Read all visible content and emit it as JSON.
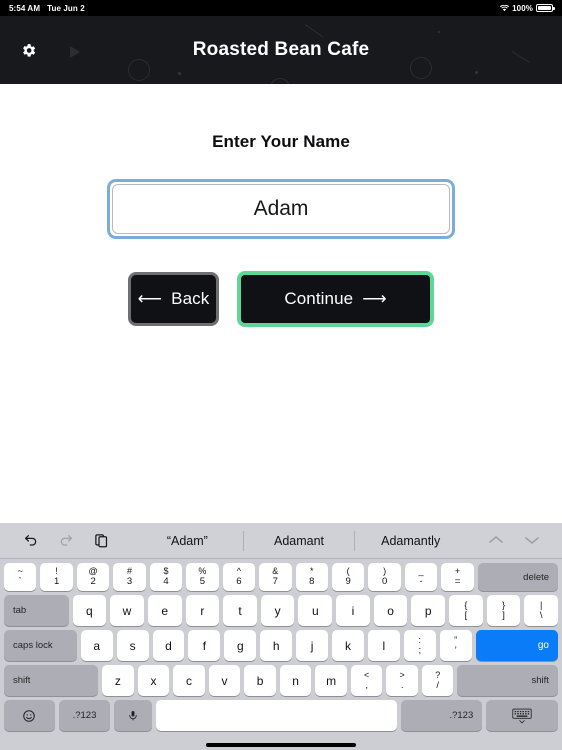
{
  "status_bar": {
    "time": "5:54 AM",
    "date": "Tue Jun 2",
    "battery_percent": "100%",
    "wifi_icon": "wifi-icon",
    "battery_icon": "battery-full-icon"
  },
  "app_header": {
    "title": "Roasted Bean Cafe",
    "settings_icon": "gear-icon",
    "background_color": "#17191c"
  },
  "main": {
    "heading": "Enter Your Name",
    "name_input": {
      "value": "Adam",
      "placeholder": "",
      "focus_ring_color": "#7cadd9"
    },
    "back_button": {
      "label": "Back",
      "icon": "arrow-left-icon",
      "border_color": "#6e6e73"
    },
    "continue_button": {
      "label": "Continue",
      "icon": "arrow-right-icon",
      "border_color": "#5fd695"
    }
  },
  "keyboard": {
    "suggestion_bar": {
      "undo_icon": "undo-icon",
      "redo_icon": "redo-icon",
      "paste_icon": "paste-icon",
      "suggestions": [
        "“Adam”",
        "Adamant",
        "Adamantly"
      ],
      "nav_up_icon": "chevron-up-icon",
      "nav_down_icon": "chevron-down-icon"
    },
    "rows": {
      "number_row": [
        {
          "type": "dual",
          "up": "~",
          "lo": "`"
        },
        {
          "type": "dual",
          "up": "!",
          "lo": "1"
        },
        {
          "type": "dual",
          "up": "@",
          "lo": "2"
        },
        {
          "type": "dual",
          "up": "#",
          "lo": "3"
        },
        {
          "type": "dual",
          "up": "$",
          "lo": "4"
        },
        {
          "type": "dual",
          "up": "%",
          "lo": "5"
        },
        {
          "type": "dual",
          "up": "^",
          "lo": "6"
        },
        {
          "type": "dual",
          "up": "&",
          "lo": "7"
        },
        {
          "type": "dual",
          "up": "*",
          "lo": "8"
        },
        {
          "type": "dual",
          "up": "(",
          "lo": "9"
        },
        {
          "type": "dual",
          "up": ")",
          "lo": "0"
        },
        {
          "type": "dual",
          "up": "_",
          "lo": "-"
        },
        {
          "type": "dual",
          "up": "+",
          "lo": "="
        },
        {
          "type": "mod",
          "label": "delete",
          "flex": 2.2,
          "align": "right"
        }
      ],
      "top_row": [
        {
          "type": "mod",
          "label": "tab",
          "flex": 1.65,
          "align": "left"
        },
        {
          "type": "key",
          "label": "q"
        },
        {
          "type": "key",
          "label": "w"
        },
        {
          "type": "key",
          "label": "e"
        },
        {
          "type": "key",
          "label": "r"
        },
        {
          "type": "key",
          "label": "t"
        },
        {
          "type": "key",
          "label": "y"
        },
        {
          "type": "key",
          "label": "u"
        },
        {
          "type": "key",
          "label": "i"
        },
        {
          "type": "key",
          "label": "o"
        },
        {
          "type": "key",
          "label": "p"
        },
        {
          "type": "dual",
          "up": "{",
          "lo": "["
        },
        {
          "type": "dual",
          "up": "}",
          "lo": "]"
        },
        {
          "type": "dual",
          "up": "|",
          "lo": "\\"
        }
      ],
      "home_row": [
        {
          "type": "mod",
          "label": "caps lock",
          "flex": 2.0,
          "align": "left"
        },
        {
          "type": "key",
          "label": "a"
        },
        {
          "type": "key",
          "label": "s"
        },
        {
          "type": "key",
          "label": "d"
        },
        {
          "type": "key",
          "label": "f"
        },
        {
          "type": "key",
          "label": "g"
        },
        {
          "type": "key",
          "label": "h"
        },
        {
          "type": "key",
          "label": "j"
        },
        {
          "type": "key",
          "label": "k"
        },
        {
          "type": "key",
          "label": "l"
        },
        {
          "type": "dual",
          "up": ":",
          "lo": ";"
        },
        {
          "type": "dual",
          "up": "”",
          "lo": "’"
        },
        {
          "type": "go",
          "label": "go",
          "flex": 2.3,
          "color": "#0a7cf7"
        }
      ],
      "shift_row": [
        {
          "type": "mod",
          "label": "shift",
          "flex": 2.7,
          "align": "left"
        },
        {
          "type": "key",
          "label": "z"
        },
        {
          "type": "key",
          "label": "x"
        },
        {
          "type": "key",
          "label": "c"
        },
        {
          "type": "key",
          "label": "v"
        },
        {
          "type": "key",
          "label": "b"
        },
        {
          "type": "key",
          "label": "n"
        },
        {
          "type": "key",
          "label": "m"
        },
        {
          "type": "dual",
          "up": "<",
          "lo": ","
        },
        {
          "type": "dual",
          "up": ">",
          "lo": "."
        },
        {
          "type": "dual",
          "up": "?",
          "lo": "/"
        },
        {
          "type": "mod",
          "label": "shift",
          "flex": 2.9,
          "align": "right"
        }
      ],
      "bottom_row": [
        {
          "type": "icon",
          "label": "☺",
          "icon_name": "emoji-icon",
          "flex": 1.35
        },
        {
          "type": "mod",
          "label": ".?123",
          "flex": 1.35,
          "align": "center"
        },
        {
          "type": "icon",
          "label": "⬤",
          "icon_name": "microphone-icon",
          "flex": 1.0
        },
        {
          "type": "space",
          "label": "",
          "flex": 6.4
        },
        {
          "type": "mod",
          "label": ".?123",
          "flex": 1.9,
          "align": "right"
        },
        {
          "type": "icon",
          "label": "",
          "icon_name": "hide-keyboard-icon",
          "flex": 1.9
        }
      ]
    }
  }
}
